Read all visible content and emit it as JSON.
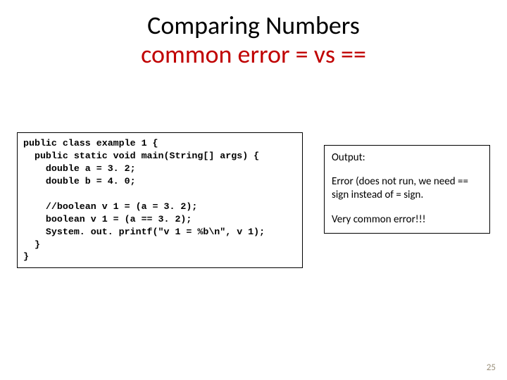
{
  "title": {
    "line1": "Comparing Numbers",
    "line2": "common error  =  vs  =="
  },
  "code": "public class example 1 {\n  public static void main(String[] args) {\n    double a = 3. 2;\n    double b = 4. 0;\n\n    //boolean v 1 = (a = 3. 2);\n    boolean v 1 = (a == 3. 2);\n    System. out. printf(\"v 1 = %b\\n\", v 1);\n  }\n}",
  "output": {
    "label": "Output:",
    "para1": "Error (does not run, we need == sign instead of = sign.",
    "para2": "Very common error!!!"
  },
  "page_number": "25"
}
